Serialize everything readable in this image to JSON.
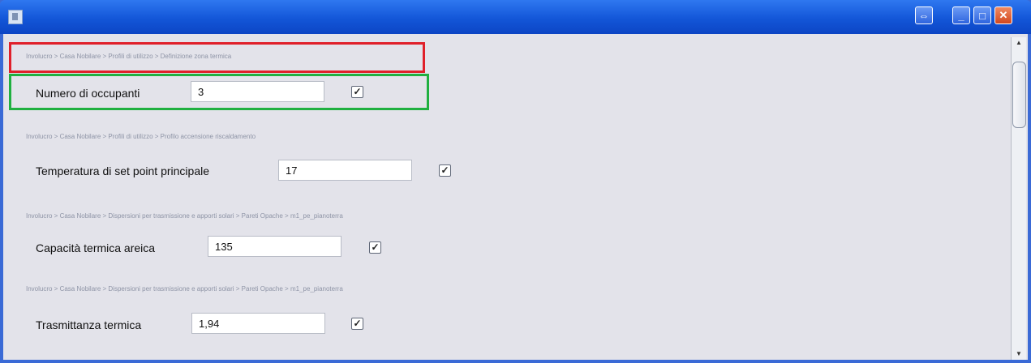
{
  "window": {
    "controls": [
      "restore-icon",
      "minimize-icon",
      "maximize-icon",
      "close-icon"
    ],
    "title_icon": "app-icon"
  },
  "fields": [
    {
      "breadcrumb": "Involucro > Casa Nobilare > Profili di utilizzo > Definizione zona termica",
      "label": "Numero di occupanti",
      "value": "3",
      "checked": true
    },
    {
      "breadcrumb": "Involucro > Casa Nobilare > Profili di utilizzo > Profilo accensione riscaldamento",
      "label": "Temperatura di set point principale",
      "value": "17",
      "checked": true
    },
    {
      "breadcrumb": "Involucro > Casa Nobilare > Dispersioni per trasmissione e apporti solari > Pareti Opache > m1_pe_pianoterra",
      "label": "Capacità termica areica",
      "value": "135",
      "checked": true
    },
    {
      "breadcrumb": "Involucro > Casa Nobilare > Dispersioni per trasmissione e apporti solari > Pareti Opache > m1_pe_pianoterra",
      "label": "Trasmittanza termica",
      "value": "1,94",
      "checked": true
    }
  ],
  "colors": {
    "titlebar": "#1356d8",
    "highlight_breadcrumb": "#e0202a",
    "highlight_field": "#20b040",
    "content_bg": "#e3e3ea"
  }
}
